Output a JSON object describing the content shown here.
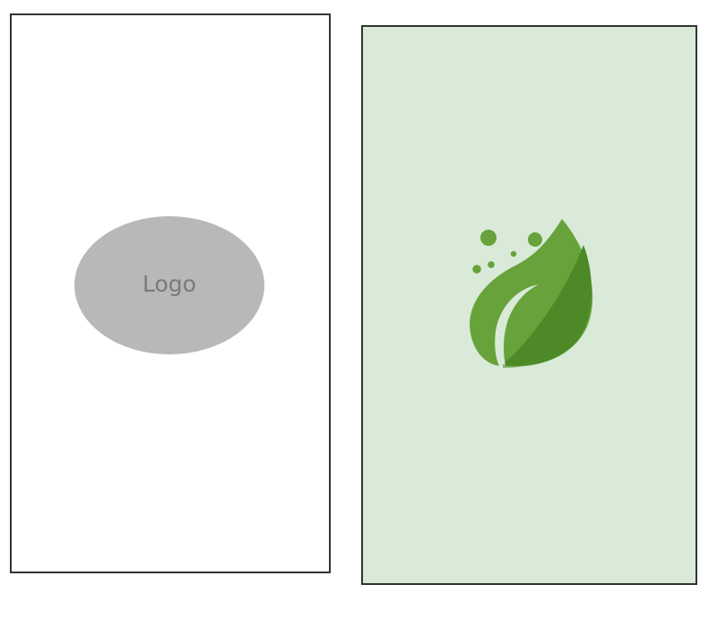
{
  "wireframe_screen": {
    "logo_placeholder_label": "Logo",
    "background": "#ffffff",
    "placeholder_fill": "#b8b8b8",
    "label_color": "#7a7a7a"
  },
  "splash_screen": {
    "background": "#d9ead9",
    "logo_icon": "leaf-icon",
    "logo_colors": {
      "light_green": "#67a33a",
      "dark_green": "#4d8a27"
    }
  },
  "frame_border_color": "#333333"
}
